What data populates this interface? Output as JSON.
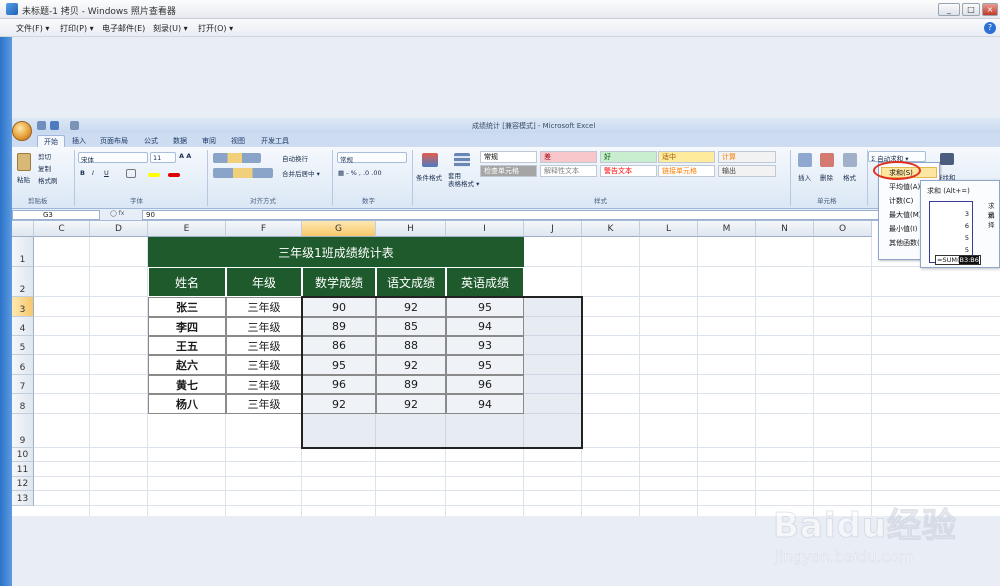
{
  "viewer": {
    "title": "未标题-1 拷贝 - Windows 照片查看器",
    "menu": [
      "文件(F) ▾",
      "打印(P) ▾",
      "电子邮件(E)",
      "刻录(U) ▾",
      "打开(O) ▾"
    ],
    "help": "?"
  },
  "excel": {
    "title": "成绩统计 [兼容模式] - Microsoft Excel",
    "tabs": [
      "开始",
      "插入",
      "页面布局",
      "公式",
      "数据",
      "审阅",
      "视图",
      "开发工具"
    ],
    "clipboard": {
      "paste": "粘贴",
      "cut": "剪切",
      "copy": "复制",
      "format_painter": "格式刷",
      "label": "剪贴板"
    },
    "font": {
      "name": "宋体",
      "size": "11",
      "label": "字体"
    },
    "alignment": {
      "wrap": "自动换行",
      "merge": "合并后居中 ▾",
      "label": "对齐方式"
    },
    "number": {
      "format": "常规",
      "label": "数字"
    },
    "styles": {
      "conditional": "条件格式",
      "table_format": "套用\n表格格式 ▾",
      "cells": [
        {
          "text": "常规",
          "bg": "#ffffff",
          "fg": "#000000"
        },
        {
          "text": "差",
          "bg": "#f8c7cc",
          "fg": "#9c0006"
        },
        {
          "text": "好",
          "bg": "#c9eecf",
          "fg": "#006100"
        },
        {
          "text": "适中",
          "bg": "#ffeb9c",
          "fg": "#9c5700"
        },
        {
          "text": "计算",
          "bg": "#f2f2f2",
          "fg": "#fa7d00"
        },
        {
          "text": "检查单元格",
          "bg": "#a5a5a5",
          "fg": "#ffffff"
        },
        {
          "text": "解释性文本",
          "bg": "#ffffff",
          "fg": "#7f7f7f"
        },
        {
          "text": "警告文本",
          "bg": "#ffffff",
          "fg": "#ff0000"
        },
        {
          "text": "链接单元格",
          "bg": "#ffffff",
          "fg": "#fa7d00"
        },
        {
          "text": "输出",
          "bg": "#f2f2f2",
          "fg": "#3f3f3f"
        }
      ],
      "label": "样式"
    },
    "cells_grp": {
      "insert": "插入",
      "delete": "删除",
      "format": "格式",
      "label": "单元格"
    },
    "editing": {
      "autosum": "Σ 自动求和 ▾",
      "find": "查找和"
    },
    "name_box": "G3",
    "formula": "90",
    "columns": [
      "C",
      "D",
      "E",
      "F",
      "G",
      "H",
      "I",
      "J",
      "K",
      "L",
      "M",
      "N",
      "O"
    ],
    "rows": [
      "1",
      "2",
      "3",
      "4",
      "5",
      "6",
      "7",
      "8",
      "9",
      "10",
      "11",
      "12",
      "13"
    ],
    "sheet_title": "三年级1班成绩统计表",
    "headers": [
      "姓名",
      "年级",
      "数学成绩",
      "语文成绩",
      "英语成绩"
    ],
    "data": [
      [
        "张三",
        "三年级",
        "90",
        "92",
        "95"
      ],
      [
        "李四",
        "三年级",
        "89",
        "85",
        "94"
      ],
      [
        "王五",
        "三年级",
        "86",
        "88",
        "93"
      ],
      [
        "赵六",
        "三年级",
        "95",
        "92",
        "95"
      ],
      [
        "黄七",
        "三年级",
        "96",
        "89",
        "96"
      ],
      [
        "杨八",
        "三年级",
        "92",
        "92",
        "94"
      ]
    ],
    "autosum_menu": [
      "求和(S)",
      "平均值(A)",
      "计数(C)",
      "最大值(M)",
      "最小值(I)",
      "其他函数(F)..."
    ],
    "tooltip": {
      "title": "求和 (Alt+=)",
      "side": [
        "求和",
        "选择"
      ],
      "nums": [
        "3",
        "6",
        "5",
        "5"
      ],
      "formula_prefix": "=SUM(",
      "formula_hl": "B3:B6"
    }
  },
  "watermark": {
    "text": "Baidu经验",
    "sub": "jingyan.baidu.com"
  }
}
